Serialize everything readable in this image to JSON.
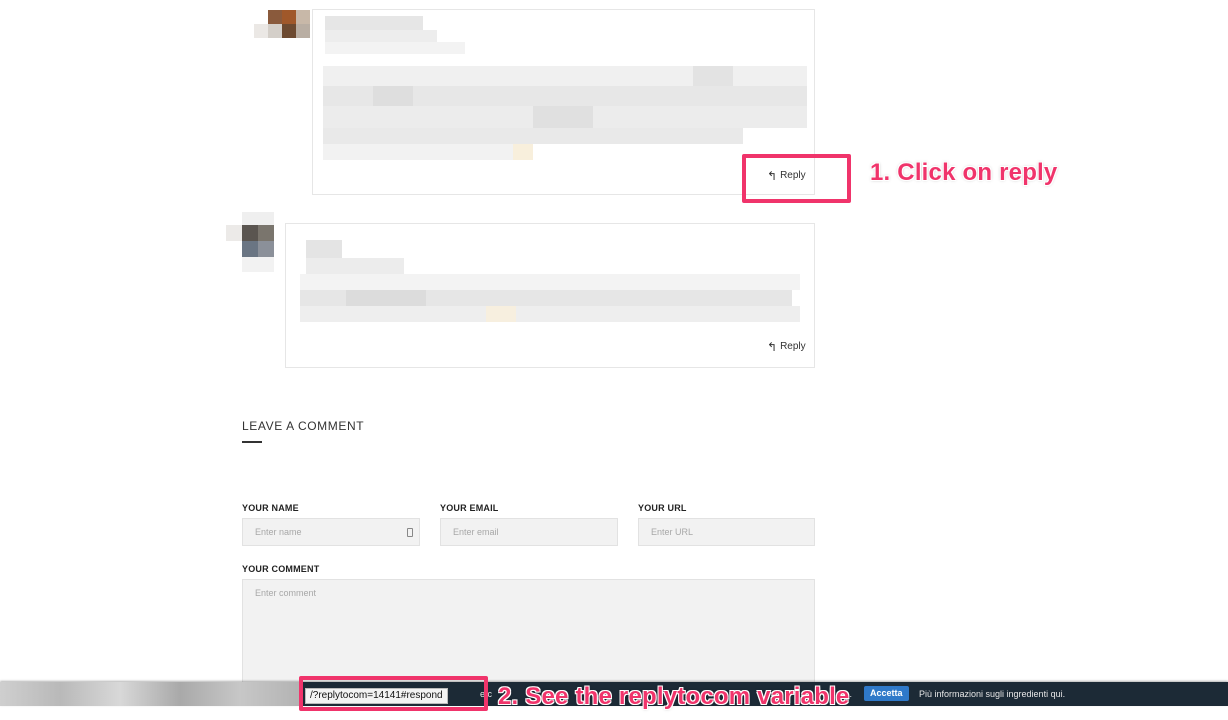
{
  "comments": [
    {
      "reply_label": "Reply"
    },
    {
      "reply_label": "Reply"
    }
  ],
  "icons": {
    "reply": "reply-arrow-icon",
    "field": "contact-card-icon"
  },
  "form": {
    "title": "LEAVE A COMMENT",
    "name_label": "YOUR NAME",
    "name_placeholder": "Enter name",
    "email_label": "YOUR EMAIL",
    "email_placeholder": "Enter email",
    "url_label": "YOUR URL",
    "url_placeholder": "Enter URL",
    "comment_label": "YOUR COMMENT",
    "comment_placeholder": "Enter comment"
  },
  "annotations": {
    "step1": "1. Click on reply",
    "step2": "2. See the replytocom variable",
    "color": "#f0346b"
  },
  "status_bar": {
    "url": "/?replytocom=14141#respond",
    "cookie_fragment_1": "e c",
    "cookie_fragment_2": "to.",
    "accept_label": "Accetta",
    "more_info": "Più informazioni sugli ingredienti qui."
  }
}
